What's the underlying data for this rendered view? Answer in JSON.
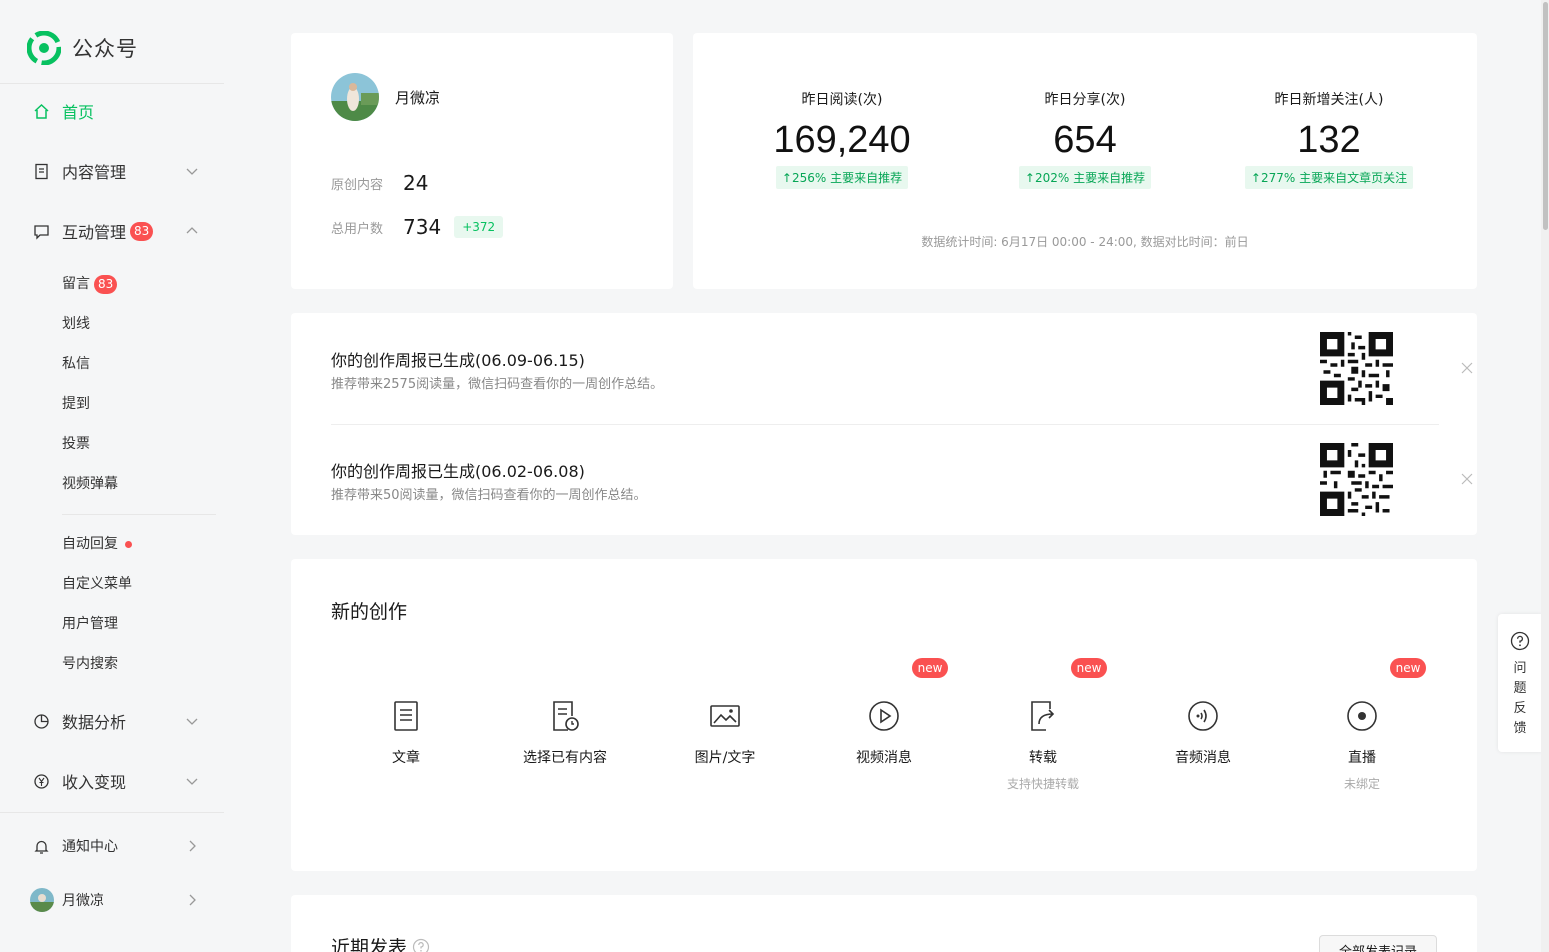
{
  "app": {
    "title": "公众号",
    "brand_color": "#07c160"
  },
  "sidebar": {
    "home": "首页",
    "content": "内容管理",
    "interaction": "互动管理",
    "interaction_badge": "83",
    "sub": [
      {
        "label": "留言",
        "badge": "83"
      },
      {
        "label": "划线"
      },
      {
        "label": "私信"
      },
      {
        "label": "提到"
      },
      {
        "label": "投票"
      },
      {
        "label": "视频弹幕"
      }
    ],
    "sub2": [
      {
        "label": "自动回复"
      },
      {
        "label": "自定义菜单"
      },
      {
        "label": "用户管理"
      },
      {
        "label": "号内搜索"
      }
    ],
    "analytics": "数据分析",
    "monetize": "收入变现",
    "notifications": "通知中心",
    "user": "月微凉"
  },
  "profile": {
    "name": "月微凉",
    "original_label": "原创内容",
    "original_value": "24",
    "users_label": "总用户数",
    "users_value": "734",
    "users_delta": "+372"
  },
  "stats": [
    {
      "title": "昨日阅读(次)",
      "value": "169,240",
      "delta": "↑256%   主要来自推荐"
    },
    {
      "title": "昨日分享(次)",
      "value": "654",
      "delta": "↑202%   主要来自推荐"
    },
    {
      "title": "昨日新增关注(人)",
      "value": "132",
      "delta": "↑277%   主要来自文章页关注"
    }
  ],
  "stats_time": "数据统计时间: 6月17日 00:00 - 24:00, 数据对比时间：前日",
  "reports": [
    {
      "title": "你的创作周报已生成(06.09-06.15)",
      "sub": "推荐带来2575阅读量，微信扫码查看你的一周创作总结。"
    },
    {
      "title": "你的创作周报已生成(06.02-06.08)",
      "sub": "推荐带来50阅读量，微信扫码查看你的一周创作总结。"
    }
  ],
  "create": {
    "title": "新的创作",
    "new_tag": "new",
    "tools": [
      {
        "label": "文章",
        "icon": "article-icon"
      },
      {
        "label": "选择已有内容",
        "icon": "existing-content-icon"
      },
      {
        "label": "图片/文字",
        "icon": "image-text-icon"
      },
      {
        "label": "视频消息",
        "icon": "video-icon"
      },
      {
        "label": "转载",
        "icon": "repost-icon",
        "sub": "支持快捷转载"
      },
      {
        "label": "音频消息",
        "icon": "audio-icon"
      },
      {
        "label": "直播",
        "icon": "live-icon",
        "sub": "未绑定"
      }
    ]
  },
  "recent": {
    "title": "近期发表",
    "all_button": "全部发表记录"
  },
  "feedback": {
    "label": "问题反馈"
  }
}
